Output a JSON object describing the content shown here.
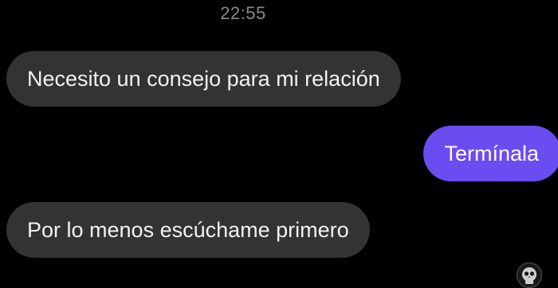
{
  "conversation": {
    "timestamp": "22:55",
    "messages": [
      {
        "sender": "other",
        "text": "Necesito un consejo para mi relación"
      },
      {
        "sender": "me",
        "text": "Termínala"
      },
      {
        "sender": "other",
        "text": "Por lo menos escúchame primero"
      }
    ],
    "avatar_icon": "skull-avatar-icon"
  },
  "colors": {
    "background": "#000000",
    "incoming_bubble": "#333333",
    "outgoing_bubble": "#6a4cf0",
    "timestamp_text": "#8a8a8a"
  }
}
